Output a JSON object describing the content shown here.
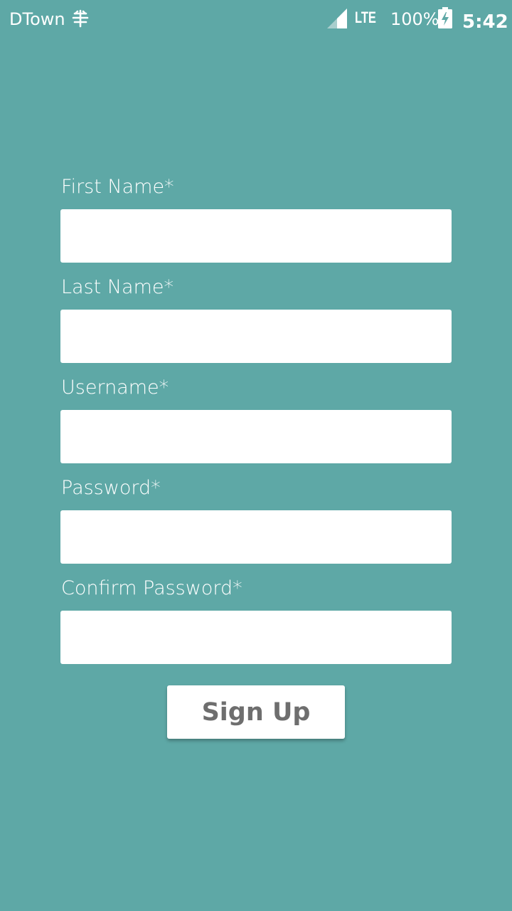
{
  "status_bar": {
    "carrier": "DTown",
    "network": "LTE",
    "battery": "100%",
    "time": "5:42",
    "icons": {
      "carrier_icon": "tree-icon",
      "signal_icon": "signal-icon",
      "battery_icon": "battery-charging-icon"
    }
  },
  "form": {
    "fields": [
      {
        "label": "First Name*",
        "value": "",
        "placeholder": ""
      },
      {
        "label": "Last Name*",
        "value": "",
        "placeholder": ""
      },
      {
        "label": "Username*",
        "value": "",
        "placeholder": ""
      },
      {
        "label": "Password*",
        "value": "",
        "placeholder": ""
      },
      {
        "label": "Confirm Password*",
        "value": "",
        "placeholder": ""
      }
    ],
    "submit_label": "Sign Up"
  },
  "colors": {
    "background": "#5ea8a6",
    "field_background": "#ffffff",
    "button_text": "#6e6e6e",
    "label_text": "#ffffff"
  }
}
